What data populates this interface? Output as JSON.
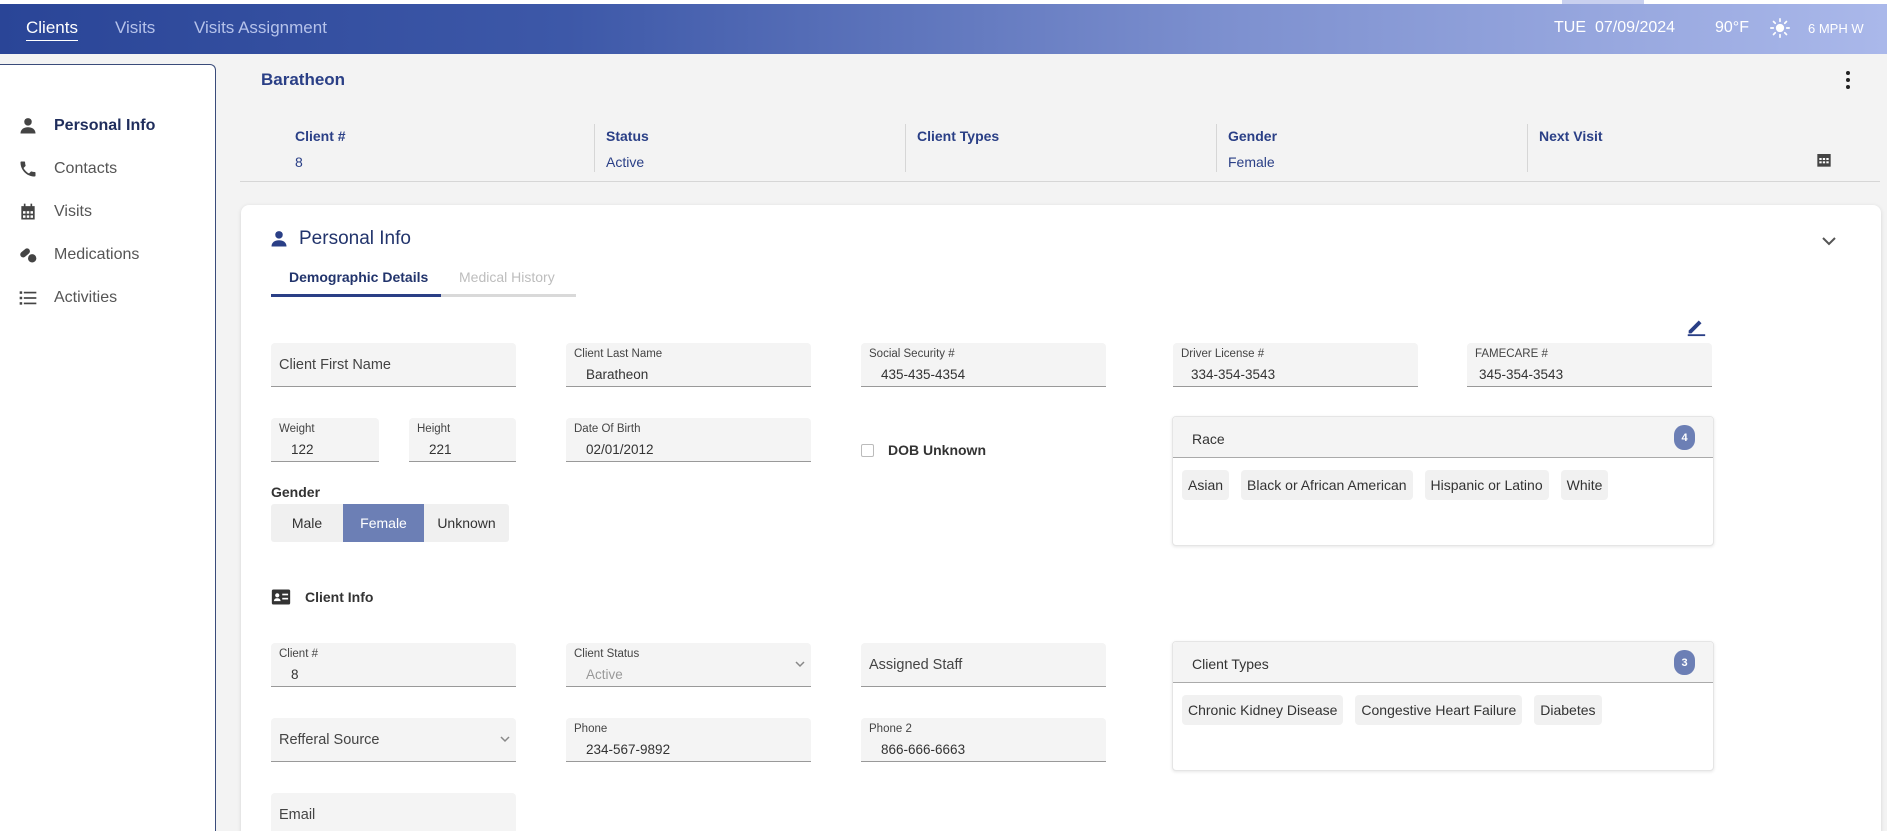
{
  "nav": {
    "tabs": [
      {
        "label": "Clients"
      },
      {
        "label": "Visits"
      },
      {
        "label": "Visits Assignment"
      }
    ],
    "day": "TUE",
    "date": "07/09/2024",
    "temperature": "90°F",
    "weather_icon": "sun-icon",
    "wind": "6 MPH W"
  },
  "sidebar": {
    "items": [
      {
        "label": "Personal Info",
        "icon": "person-icon"
      },
      {
        "label": "Contacts",
        "icon": "phone-icon"
      },
      {
        "label": "Visits",
        "icon": "calendar-icon"
      },
      {
        "label": "Medications",
        "icon": "pills-icon"
      },
      {
        "label": "Activities",
        "icon": "list-icon"
      }
    ]
  },
  "client": {
    "name": "Baratheon",
    "summary": [
      {
        "label": "Client #",
        "value": "8"
      },
      {
        "label": "Status",
        "value": "Active"
      },
      {
        "label": "Client Types",
        "value": ""
      },
      {
        "label": "Gender",
        "value": "Female"
      },
      {
        "label": "Next Visit",
        "value": ""
      }
    ]
  },
  "panel": {
    "title": "Personal Info",
    "subtabs": [
      {
        "label": "Demographic Details"
      },
      {
        "label": "Medical History"
      }
    ]
  },
  "demographics": {
    "first_name": {
      "label": "Client First Name",
      "value": ""
    },
    "last_name": {
      "label": "Client Last Name",
      "value": "Baratheon"
    },
    "ssn": {
      "label": "Social Security #",
      "value": "435-435-4354"
    },
    "driver_license": {
      "label": "Driver License #",
      "value": "334-354-3543"
    },
    "famecare": {
      "label": "FAMECARE #",
      "value": "345-354-3543"
    },
    "weight": {
      "label": "Weight",
      "value": "122"
    },
    "height": {
      "label": "Height",
      "value": "221"
    },
    "dob": {
      "label": "Date Of Birth",
      "value": "02/01/2012"
    },
    "dob_unknown": {
      "label": "DOB Unknown",
      "checked": false
    },
    "gender": {
      "label": "Gender",
      "options": [
        "Male",
        "Female",
        "Unknown"
      ],
      "selected": "Female"
    },
    "race": {
      "label": "Race",
      "count": "4",
      "items": [
        "Asian",
        "Black or African American",
        "Hispanic or Latino",
        "White"
      ]
    }
  },
  "client_info": {
    "title": "Client Info",
    "client_num": {
      "label": "Client #",
      "value": "8"
    },
    "status": {
      "label": "Client Status",
      "value": "Active"
    },
    "assigned_staff": {
      "label": "Assigned Staff",
      "value": ""
    },
    "client_types": {
      "label": "Client Types",
      "count": "3",
      "items": [
        "Chronic Kidney Disease",
        "Congestive Heart Failure",
        "Diabetes"
      ]
    },
    "referral_source": {
      "label": "Refferal Source",
      "value": ""
    },
    "phone": {
      "label": "Phone",
      "value": "234-567-9892"
    },
    "phone2": {
      "label": "Phone 2",
      "value": "866-666-6663"
    },
    "email": {
      "label": "Email",
      "value": ""
    }
  },
  "colors": {
    "accent": "#2a3f86",
    "selected": "#6c7fb5"
  }
}
